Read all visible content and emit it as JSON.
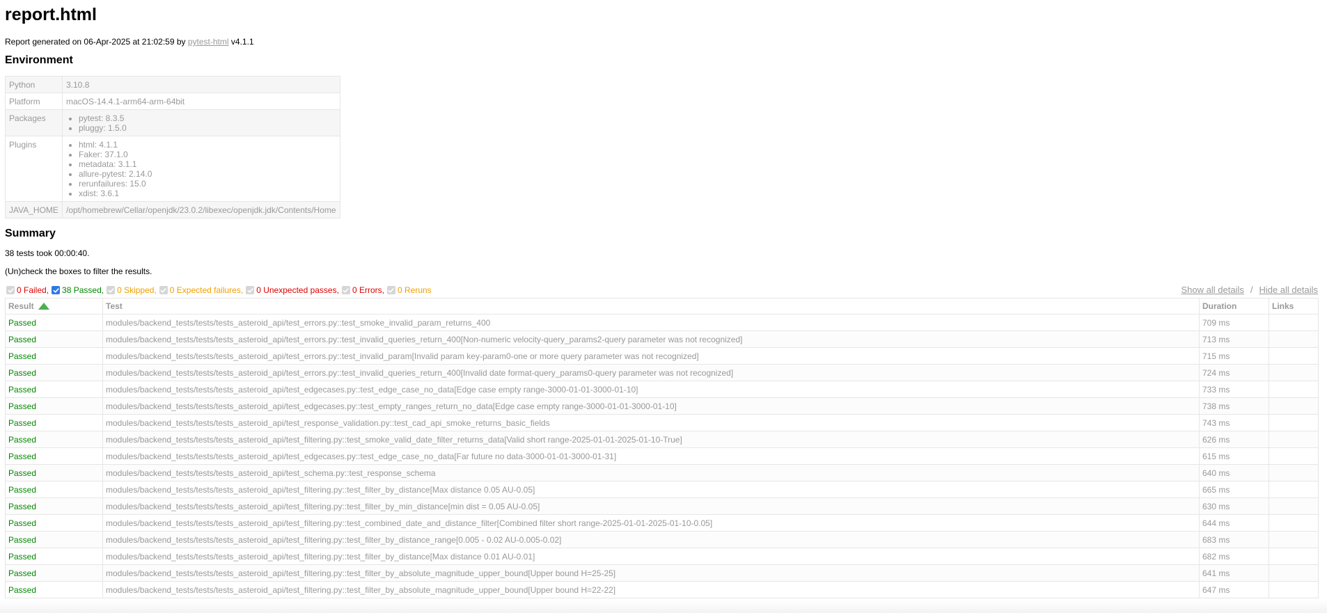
{
  "title": "report.html",
  "generated": {
    "prefix": "Report generated on 06-Apr-2025 at 21:02:59 by",
    "link": "pytest-html",
    "version": "v4.1.1"
  },
  "environment": {
    "heading": "Environment",
    "rows": [
      {
        "key": "Python",
        "value": "3.10.8"
      },
      {
        "key": "Platform",
        "value": "macOS-14.4.1-arm64-arm-64bit"
      },
      {
        "key": "Packages",
        "items": [
          "pytest: 8.3.5",
          "pluggy: 1.5.0"
        ]
      },
      {
        "key": "Plugins",
        "items": [
          "html: 4.1.1",
          "Faker: 37.1.0",
          "metadata: 3.1.1",
          "allure-pytest: 2.14.0",
          "rerunfailures: 15.0",
          "xdist: 3.6.1"
        ]
      },
      {
        "key": "JAVA_HOME",
        "value": "/opt/homebrew/Cellar/openjdk/23.0.2/libexec/openjdk.jdk/Contents/Home"
      }
    ]
  },
  "summary": {
    "heading": "Summary",
    "took": "38 tests took 00:00:40.",
    "hint": "(Un)check the boxes to filter the results."
  },
  "filters": [
    {
      "label": "0 Failed,",
      "checked": false,
      "color": "red"
    },
    {
      "label": "38 Passed,",
      "checked": true,
      "color": "green"
    },
    {
      "label": "0 Skipped,",
      "checked": false,
      "color": "orange"
    },
    {
      "label": "0 Expected failures,",
      "checked": false,
      "color": "orange"
    },
    {
      "label": "0 Unexpected passes,",
      "checked": false,
      "color": "red"
    },
    {
      "label": "0 Errors,",
      "checked": false,
      "color": "red"
    },
    {
      "label": "0 Reruns",
      "checked": false,
      "color": "orange"
    }
  ],
  "details": {
    "show": "Show all details",
    "sep": "/",
    "hide": "Hide all details"
  },
  "table": {
    "headers": {
      "result": "Result",
      "test": "Test",
      "duration": "Duration",
      "links": "Links"
    },
    "rows": [
      {
        "result": "Passed",
        "test": "modules/backend_tests/tests/tests_asteroid_api/test_errors.py::test_smoke_invalid_param_returns_400",
        "duration": "709 ms"
      },
      {
        "result": "Passed",
        "test": "modules/backend_tests/tests/tests_asteroid_api/test_errors.py::test_invalid_queries_return_400[Non-numeric velocity-query_params2-query parameter was not recognized]",
        "duration": "713 ms"
      },
      {
        "result": "Passed",
        "test": "modules/backend_tests/tests/tests_asteroid_api/test_errors.py::test_invalid_param[Invalid param key-param0-one or more query parameter was not recognized]",
        "duration": "715 ms"
      },
      {
        "result": "Passed",
        "test": "modules/backend_tests/tests/tests_asteroid_api/test_errors.py::test_invalid_queries_return_400[Invalid date format-query_params0-query parameter was not recognized]",
        "duration": "724 ms"
      },
      {
        "result": "Passed",
        "test": "modules/backend_tests/tests/tests_asteroid_api/test_edgecases.py::test_edge_case_no_data[Edge case empty range-3000-01-01-3000-01-10]",
        "duration": "733 ms"
      },
      {
        "result": "Passed",
        "test": "modules/backend_tests/tests/tests_asteroid_api/test_edgecases.py::test_empty_ranges_return_no_data[Edge case empty range-3000-01-01-3000-01-10]",
        "duration": "738 ms"
      },
      {
        "result": "Passed",
        "test": "modules/backend_tests/tests/tests_asteroid_api/test_response_validation.py::test_cad_api_smoke_returns_basic_fields",
        "duration": "743 ms"
      },
      {
        "result": "Passed",
        "test": "modules/backend_tests/tests/tests_asteroid_api/test_filtering.py::test_smoke_valid_date_filter_returns_data[Valid short range-2025-01-01-2025-01-10-True]",
        "duration": "626 ms"
      },
      {
        "result": "Passed",
        "test": "modules/backend_tests/tests/tests_asteroid_api/test_edgecases.py::test_edge_case_no_data[Far future no data-3000-01-01-3000-01-31]",
        "duration": "615 ms"
      },
      {
        "result": "Passed",
        "test": "modules/backend_tests/tests/tests_asteroid_api/test_schema.py::test_response_schema",
        "duration": "640 ms"
      },
      {
        "result": "Passed",
        "test": "modules/backend_tests/tests/tests_asteroid_api/test_filtering.py::test_filter_by_distance[Max distance 0.05 AU-0.05]",
        "duration": "665 ms"
      },
      {
        "result": "Passed",
        "test": "modules/backend_tests/tests/tests_asteroid_api/test_filtering.py::test_filter_by_min_distance[min dist = 0.05 AU-0.05]",
        "duration": "630 ms"
      },
      {
        "result": "Passed",
        "test": "modules/backend_tests/tests/tests_asteroid_api/test_filtering.py::test_combined_date_and_distance_filter[Combined filter short range-2025-01-01-2025-01-10-0.05]",
        "duration": "644 ms"
      },
      {
        "result": "Passed",
        "test": "modules/backend_tests/tests/tests_asteroid_api/test_filtering.py::test_filter_by_distance_range[0.005 - 0.02 AU-0.005-0.02]",
        "duration": "683 ms"
      },
      {
        "result": "Passed",
        "test": "modules/backend_tests/tests/tests_asteroid_api/test_filtering.py::test_filter_by_distance[Max distance 0.01 AU-0.01]",
        "duration": "682 ms"
      },
      {
        "result": "Passed",
        "test": "modules/backend_tests/tests/tests_asteroid_api/test_filtering.py::test_filter_by_absolute_magnitude_upper_bound[Upper bound H=25-25]",
        "duration": "641 ms"
      },
      {
        "result": "Passed",
        "test": "modules/backend_tests/tests/tests_asteroid_api/test_filtering.py::test_filter_by_absolute_magnitude_upper_bound[Upper bound H=22-22]",
        "duration": "647 ms"
      }
    ]
  }
}
